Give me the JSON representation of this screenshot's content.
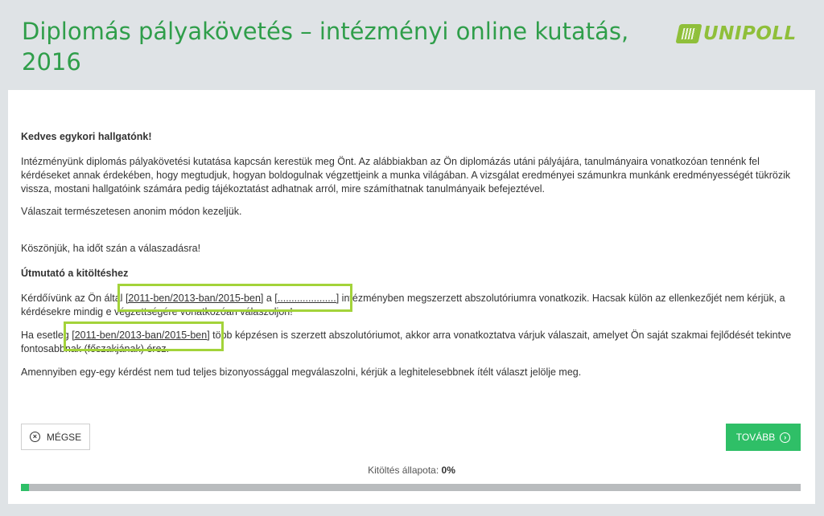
{
  "header": {
    "title": "Diplomás pályakövetés – intézményi online kutatás, 2016",
    "logo_text": "UNIPOLL",
    "logo_icon": "unipoll-logo-icon"
  },
  "content": {
    "greeting": "Kedves egykori hallgatónk!",
    "intro": "Intézményünk diplomás pályakövetési kutatása kapcsán kerestük meg Önt. Az alábbiakban az Ön diplomázás utáni pályájára, tanulmányaira vonatkozóan tennénk fel kérdéseket annak érdekében, hogy megtudjuk, hogyan boldogulnak végzettjeink a munka világában. A vizsgálat eredményei számunkra munkánk eredményességét tükrözik vissza, mostani hallgatóink számára pedig tájékoztatást adhatnak arról, mire számíthatnak tanulmányaik befejeztével.",
    "anon": "Válaszait természetesen anonim módon kezeljük.",
    "thanks": "Köszönjük, ha időt szán a válaszadásra!",
    "guide_title": "Útmutató a kitöltéshez",
    "guide1_a": "Kérdőívünk az Ön által ",
    "guide1_years": "[2011-ben/2013-ban/2015-ben]",
    "guide1_b": " a ",
    "guide1_inst": "[.....................]",
    "guide1_c": " intézményben megszerzett abszolutóriumra vonatkozik. Hacsak külön az ellenkezőjét nem kérjük, a kérdésekre mindig e végzettségére vonatkozóan válaszoljon!",
    "guide2_a": "Ha esetleg ",
    "guide2_years": "[2011-ben/2013-ban/2015-ben]",
    "guide2_b": " több képzésen is szerzett abszolutóriumot, akkor arra vonatkoztatva várjuk válaszait, amelyet Ön saját szakmai fejlődését tekintve fontosabbnak (főszakjának) érez.",
    "guide3": "Amennyiben egy-egy kérdést nem tud teljes bizonyossággal megválaszolni, kérjük a leghitelesebbnek ítélt választ jelölje meg."
  },
  "buttons": {
    "cancel_label": "MÉGSE",
    "cancel_icon": "close-circle-icon",
    "next_label": "TOVÁBB",
    "next_icon": "arrow-right-circle-icon"
  },
  "status": {
    "label": "Kitöltés állapota: ",
    "percent": "0%",
    "progress_fraction": 0.01
  },
  "colors": {
    "title_green": "#2f9e4a",
    "button_green": "#2fbf67",
    "highlight": "#a3d33a",
    "logo_green": "#8fbf3a"
  }
}
